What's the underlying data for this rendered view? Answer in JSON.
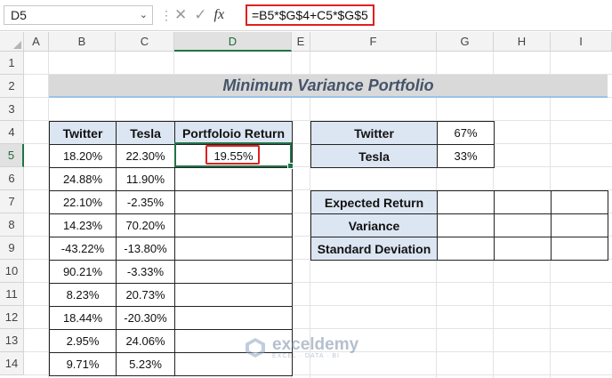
{
  "name_box": "D5",
  "formula": "=B5*$G$4+C5*$G$5",
  "columns": [
    "A",
    "B",
    "C",
    "D",
    "E",
    "F",
    "G",
    "H",
    "I"
  ],
  "rows": [
    "1",
    "2",
    "3",
    "4",
    "5",
    "6",
    "7",
    "8",
    "9",
    "10",
    "11",
    "12",
    "13",
    "14"
  ],
  "title": "Minimum Variance Portfolio",
  "main_table": {
    "headers": [
      "Twitter",
      "Tesla",
      "Portfoloio Return"
    ],
    "rows": [
      [
        "18.20%",
        "22.30%",
        "19.55%"
      ],
      [
        "24.88%",
        "11.90%",
        ""
      ],
      [
        "22.10%",
        "-2.35%",
        ""
      ],
      [
        "14.23%",
        "70.20%",
        ""
      ],
      [
        "-43.22%",
        "-13.80%",
        ""
      ],
      [
        "90.21%",
        "-3.33%",
        ""
      ],
      [
        "8.23%",
        "20.73%",
        ""
      ],
      [
        "18.44%",
        "-20.30%",
        ""
      ],
      [
        "2.95%",
        "24.06%",
        ""
      ],
      [
        "9.71%",
        "5.23%",
        ""
      ]
    ]
  },
  "weights": [
    {
      "label": "Twitter",
      "value": "67%"
    },
    {
      "label": "Tesla",
      "value": "33%"
    }
  ],
  "stats": [
    "Expected Return",
    "Variance",
    "Standard Deviation"
  ],
  "watermark": {
    "brand": "exceldemy",
    "tagline": "EXCEL · DATA · BI"
  }
}
